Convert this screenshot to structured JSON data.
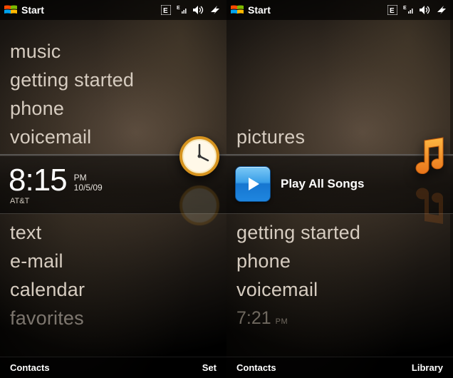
{
  "statusbar": {
    "start_label": "Start"
  },
  "screen1": {
    "above": [
      "music",
      "getting started",
      "phone",
      "voicemail"
    ],
    "time": "8:15",
    "ampm": "PM",
    "date": "10/5/09",
    "carrier": "AT&T",
    "below": [
      "text",
      "e-mail",
      "calendar",
      "favorites"
    ],
    "softkeys": {
      "left": "Contacts",
      "right": "Set"
    }
  },
  "screen2": {
    "above": [
      "pictures"
    ],
    "play_label": "Play All Songs",
    "below": [
      "getting started",
      "phone",
      "voicemail"
    ],
    "time": "7:21",
    "ampm": "PM",
    "softkeys": {
      "left": "Contacts",
      "right": "Library"
    }
  },
  "icons": {
    "windows": "windows-logo",
    "edge_net": "E",
    "signal": "signal",
    "speaker": "speaker",
    "plug": "plug",
    "clock": "clock",
    "music": "music-note",
    "play": "play"
  }
}
